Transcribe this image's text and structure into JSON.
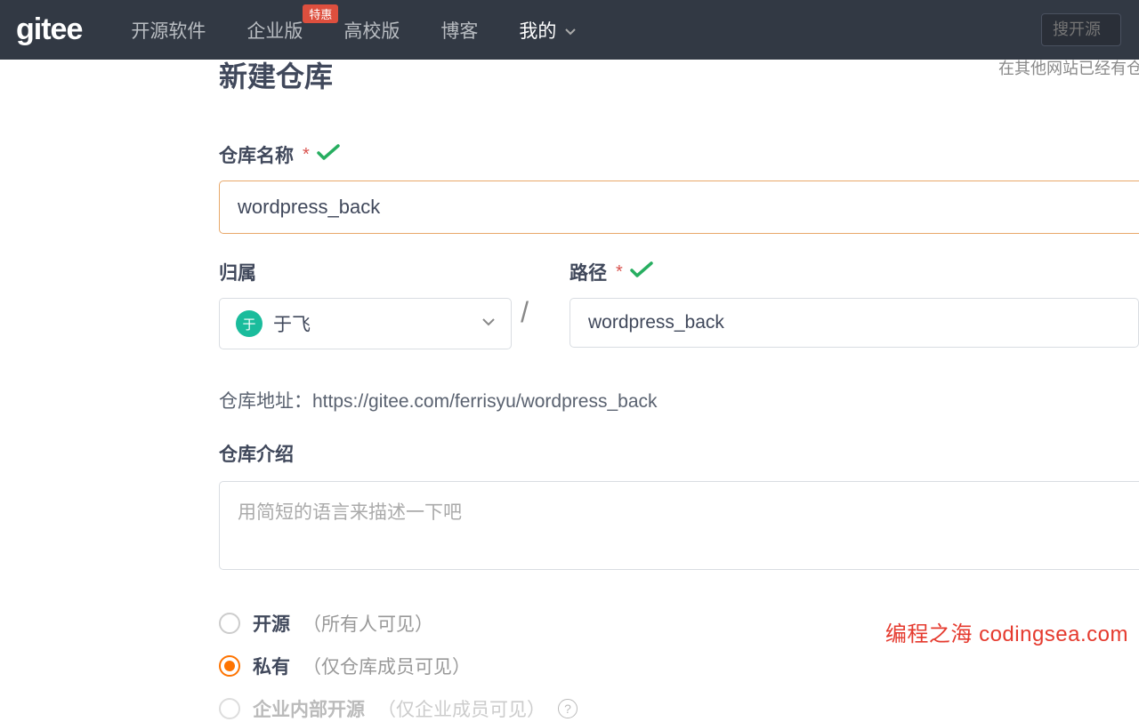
{
  "nav": {
    "logo": "gitee",
    "items": [
      {
        "label": "开源软件"
      },
      {
        "label": "企业版",
        "badge": "特惠"
      },
      {
        "label": "高校版"
      },
      {
        "label": "博客"
      },
      {
        "label": "我的",
        "active": true,
        "caret": true
      }
    ],
    "search_placeholder": "搜开源"
  },
  "page": {
    "title": "新建仓库",
    "right_hint": "在其他网站已经有仓"
  },
  "form": {
    "name_label": "仓库名称",
    "name_value": "wordpress_back",
    "owner_label": "归属",
    "owner_avatar_char": "于",
    "owner_value": "于飞",
    "path_label": "路径",
    "path_value": "wordpress_back",
    "addr_label": "仓库地址：",
    "addr_value": "https://gitee.com/ferrisyu/wordpress_back",
    "desc_label": "仓库介绍",
    "desc_placeholder": "用简短的语言来描述一下吧",
    "visibility": [
      {
        "key": "open",
        "label": "开源",
        "hint": "（所有人可见）",
        "selected": false,
        "disabled": false
      },
      {
        "key": "private",
        "label": "私有",
        "hint": "（仅仓库成员可见）",
        "selected": true,
        "disabled": false
      },
      {
        "key": "enterprise",
        "label": "企业内部开源",
        "hint": "（仅企业成员可见）",
        "selected": false,
        "disabled": true
      }
    ]
  },
  "watermark": "编程之海 codingsea.com"
}
